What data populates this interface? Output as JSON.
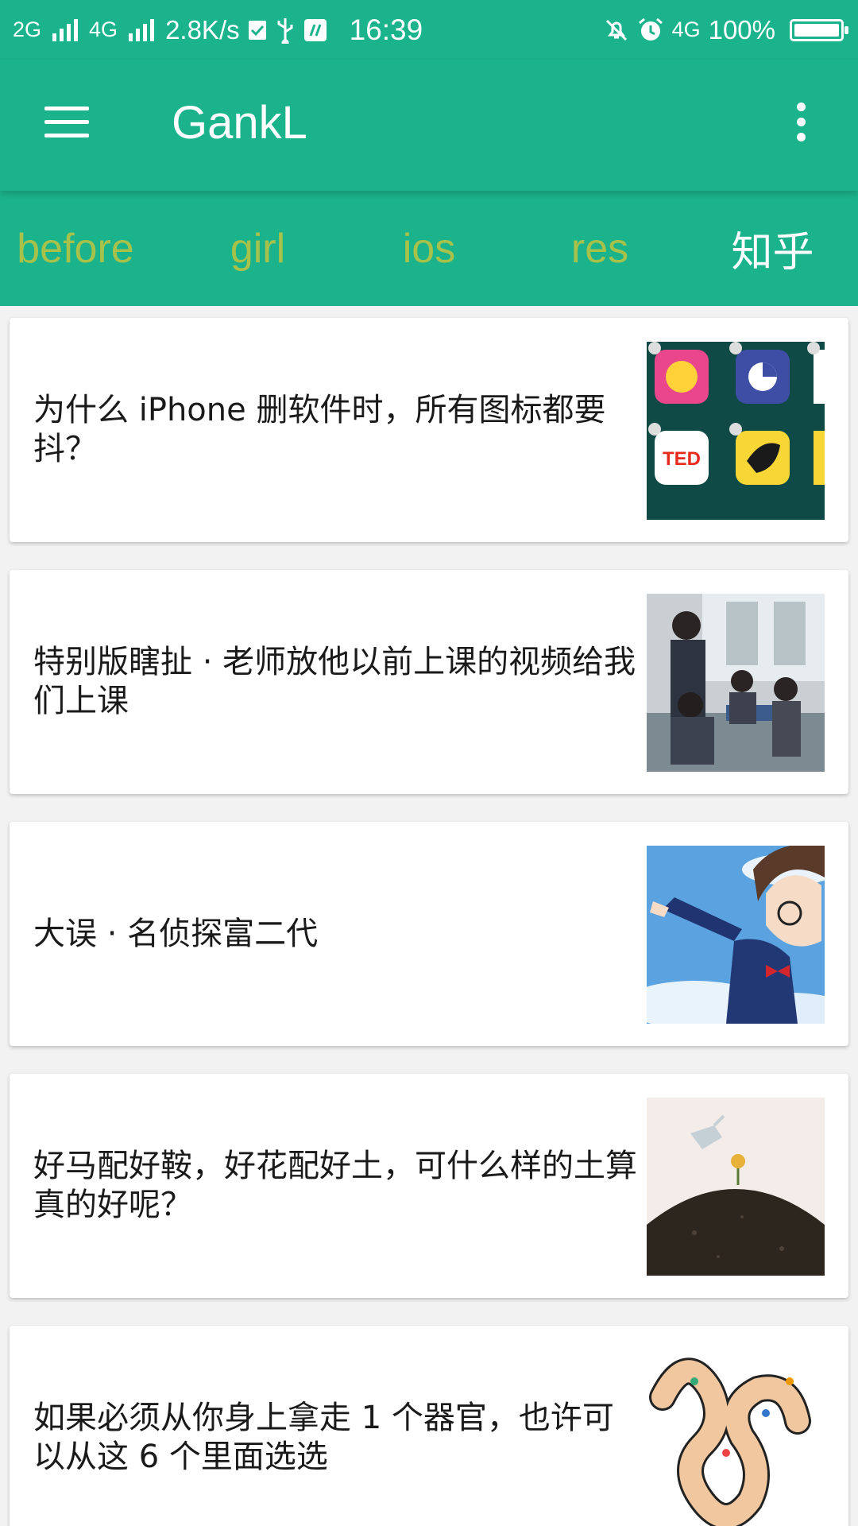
{
  "status_bar": {
    "net1": "2G",
    "net2": "4G",
    "speed": "2.8K/s",
    "time": "16:39",
    "net3": "4G",
    "battery": "100%",
    "icons": [
      "signal-icon",
      "check-icon",
      "usb-icon",
      "debug-icon",
      "mute-icon",
      "alarm-icon",
      "battery-icon"
    ]
  },
  "app_bar": {
    "title": "GankL",
    "menu_icon": "hamburger-icon",
    "overflow_icon": "more-vert-icon"
  },
  "tabs": [
    {
      "label": "before",
      "active": false
    },
    {
      "label": "girl",
      "active": false
    },
    {
      "label": "ios",
      "active": false
    },
    {
      "label": "res",
      "active": false
    },
    {
      "label": "知乎",
      "active": true
    }
  ],
  "colors": {
    "primary": "#1bb38c",
    "tab_inactive": "#a7c24a",
    "tab_active": "#ffffff",
    "background": "#f2f2f2"
  },
  "feed": [
    {
      "title": "为什么 iPhone 删软件时，所有图标都要抖？",
      "thumb": "app-icons-thumbnail"
    },
    {
      "title": "特别版瞎扯 · 老师放他以前上课的视频给我们上课",
      "thumb": "classroom-thumbnail"
    },
    {
      "title": "大误 · 名侦探富二代",
      "thumb": "anime-thumbnail"
    },
    {
      "title": "好马配好鞍，好花配好土，可什么样的土算真的好呢？",
      "thumb": "soil-thumbnail"
    },
    {
      "title": "如果必须从你身上拿走 1 个器官，也许可以从这 6 个里面选选",
      "thumb": "organ-illustration-thumbnail"
    }
  ]
}
